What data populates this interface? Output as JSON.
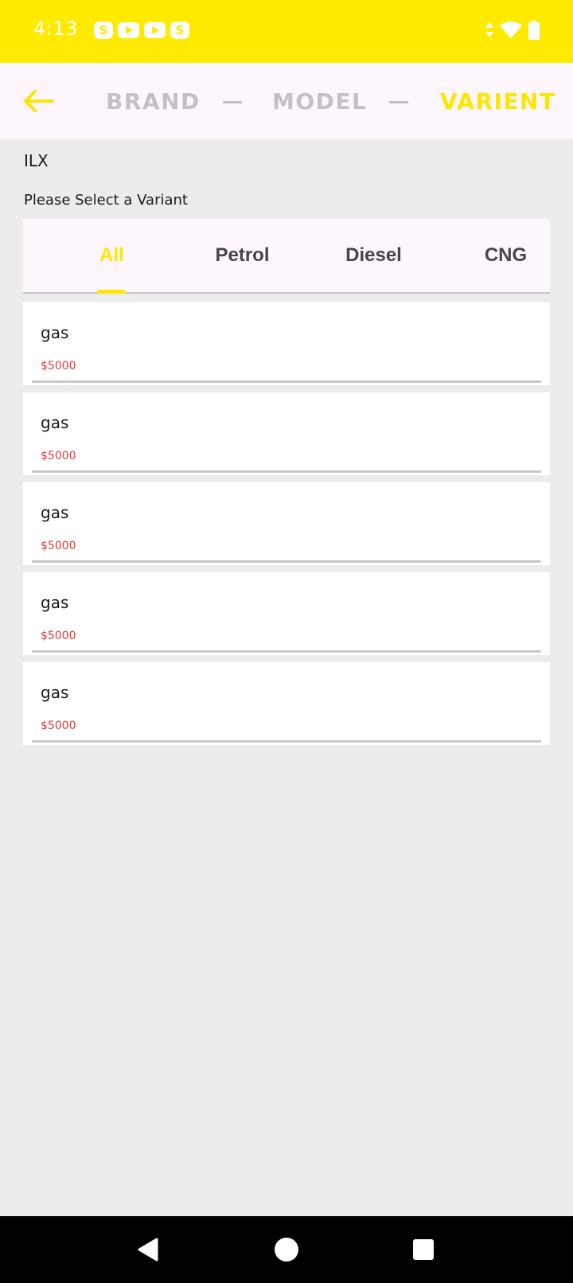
{
  "status_bar": {
    "time": "4:13",
    "app_icons": [
      "skype-icon",
      "youtube-icon",
      "youtube-icon",
      "skype-icon"
    ],
    "system_icons": [
      "data-arrows-icon",
      "wifi-icon",
      "battery-icon"
    ]
  },
  "header": {
    "back_icon": "arrow-left-icon",
    "steps": {
      "brand": "BRAND",
      "model": "MODEL",
      "variant": "VARIENT"
    }
  },
  "model_name": "ILX",
  "prompt": "Please Select a Variant",
  "tabs": {
    "all": "All",
    "petrol": "Petrol",
    "diesel": "Diesel",
    "cng": "CNG",
    "selected": "All"
  },
  "variants": [
    {
      "title": "gas",
      "price": "$5000"
    },
    {
      "title": "gas",
      "price": "$5000"
    },
    {
      "title": "gas",
      "price": "$5000"
    },
    {
      "title": "gas",
      "price": "$5000"
    },
    {
      "title": "gas",
      "price": "$5000"
    }
  ],
  "nav_bar": {
    "icons": [
      "back-triangle-icon",
      "home-circle-icon",
      "recents-square-icon"
    ]
  },
  "colors": {
    "accent": "#ffea00",
    "price": "#e53935",
    "inactive_step": "#c4c0c4"
  }
}
